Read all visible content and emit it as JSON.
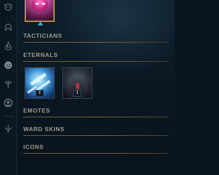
{
  "rail": {
    "icons": [
      "mask-icon",
      "champion-head-icon",
      "flame-icon",
      "emote-face-icon",
      "tree-icon",
      "circle-portrait-icon",
      "ward-icon"
    ]
  },
  "top_item": {
    "name": "selected-item"
  },
  "sections": {
    "tacticians": "TACTICIANS",
    "eternals": "ETERNALS",
    "emotes": "EMOTES",
    "ward_skins": "WARD SKINS",
    "icons": "ICONS"
  },
  "eternals": {
    "cards": [
      {
        "badge": "I"
      },
      {
        "badge": "I"
      }
    ]
  },
  "colors": {
    "accent_gold": "#b58f4b",
    "section_text": "#a39c8c",
    "selection_blue": "#3aa7d6"
  }
}
